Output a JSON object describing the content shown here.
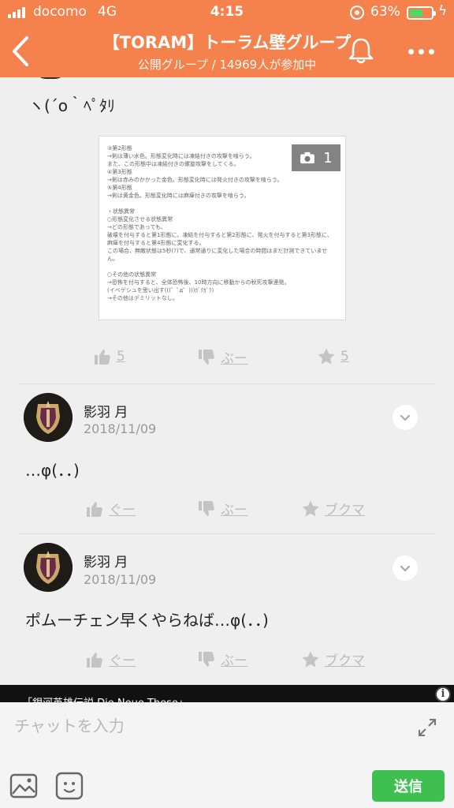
{
  "status_bar": {
    "carrier": "docomo",
    "network": "4G",
    "time": "4:15",
    "battery_percent": "63%",
    "battery_level": 0.63
  },
  "header": {
    "back_icon": "chevron-left-icon",
    "title": "【TORAM】トーラム壁グループ",
    "subtitle": "公開グループ / 14969人が参加中",
    "bell_icon": "bell-icon",
    "more_icon": "more-dots-icon"
  },
  "post": {
    "text": "ヽ(´o｀ﾍﾟﾀﾘ",
    "photo": {
      "count": "1",
      "camera_icon": "camera-icon",
      "lines": [
        "③第2形態",
        "→剣は薄い水色。形態変化時には凍結付きの攻撃を喰らう。",
        "また、この形態中は凍結付きの螺旋攻撃をしてくる。",
        "④第3形態",
        "→剣は赤みのかかった金色。形態変化時には発火付きの攻撃を喰らう。",
        "⑤第4形態",
        "→剣は黄金色。形態変化時には麻痺付きの攻撃を喰らう。",
        "",
        "・状態異常",
        "○形態変化させる状態異常",
        "→どの形態であっても、",
        "破壊を付与すると第1形態に、凍結を付与すると第2形態に、発火を付与すると第3形態に、",
        "麻痺を付与すると第4形態に変化する。",
        "この場合、無敵状態は5秒(?)で、通常通りに変化した場合の時間はまだ計測できていませ",
        "ん。",
        "",
        "○その他の状態異常",
        "→恐怖を付与すると、全体恐怖後、10時方向に移動からの秋死攻撃連発。",
        "(イベゲシュを思い出す(((゜ﾟд゜)))ｶﾞｸｶﾞｸ)",
        "→その他はデミリットなし。"
      ]
    },
    "actions": {
      "like": "5",
      "dislike": "ぶー",
      "bookmark": "5"
    }
  },
  "comments": [
    {
      "username": "影羽 月",
      "date": "2018/11/09",
      "text": "…φ(．．)",
      "actions": {
        "like": "ぐー",
        "dislike": "ぶー",
        "bookmark": "ブクマ"
      }
    },
    {
      "username": "影羽 月",
      "date": "2018/11/09",
      "text": "ポムーチェン早くやらねば…φ(．．)",
      "actions": {
        "like": "ぐー",
        "dislike": "ぶー",
        "bookmark": "ブクマ"
      }
    }
  ],
  "ad": {
    "text": "「銀河英雄伝説 Die Neue These」",
    "info_label": "i"
  },
  "composer": {
    "placeholder": "チャットを入力",
    "value": "",
    "send_label": "送信",
    "expand_icon": "expand-arrows-icon",
    "image_icon": "image-icon",
    "sticker_icon": "sticker-icon"
  },
  "colors": {
    "header_bg": "#f5814d",
    "send_bg": "#3fbf4f",
    "action_grey": "#bbbbbb"
  }
}
